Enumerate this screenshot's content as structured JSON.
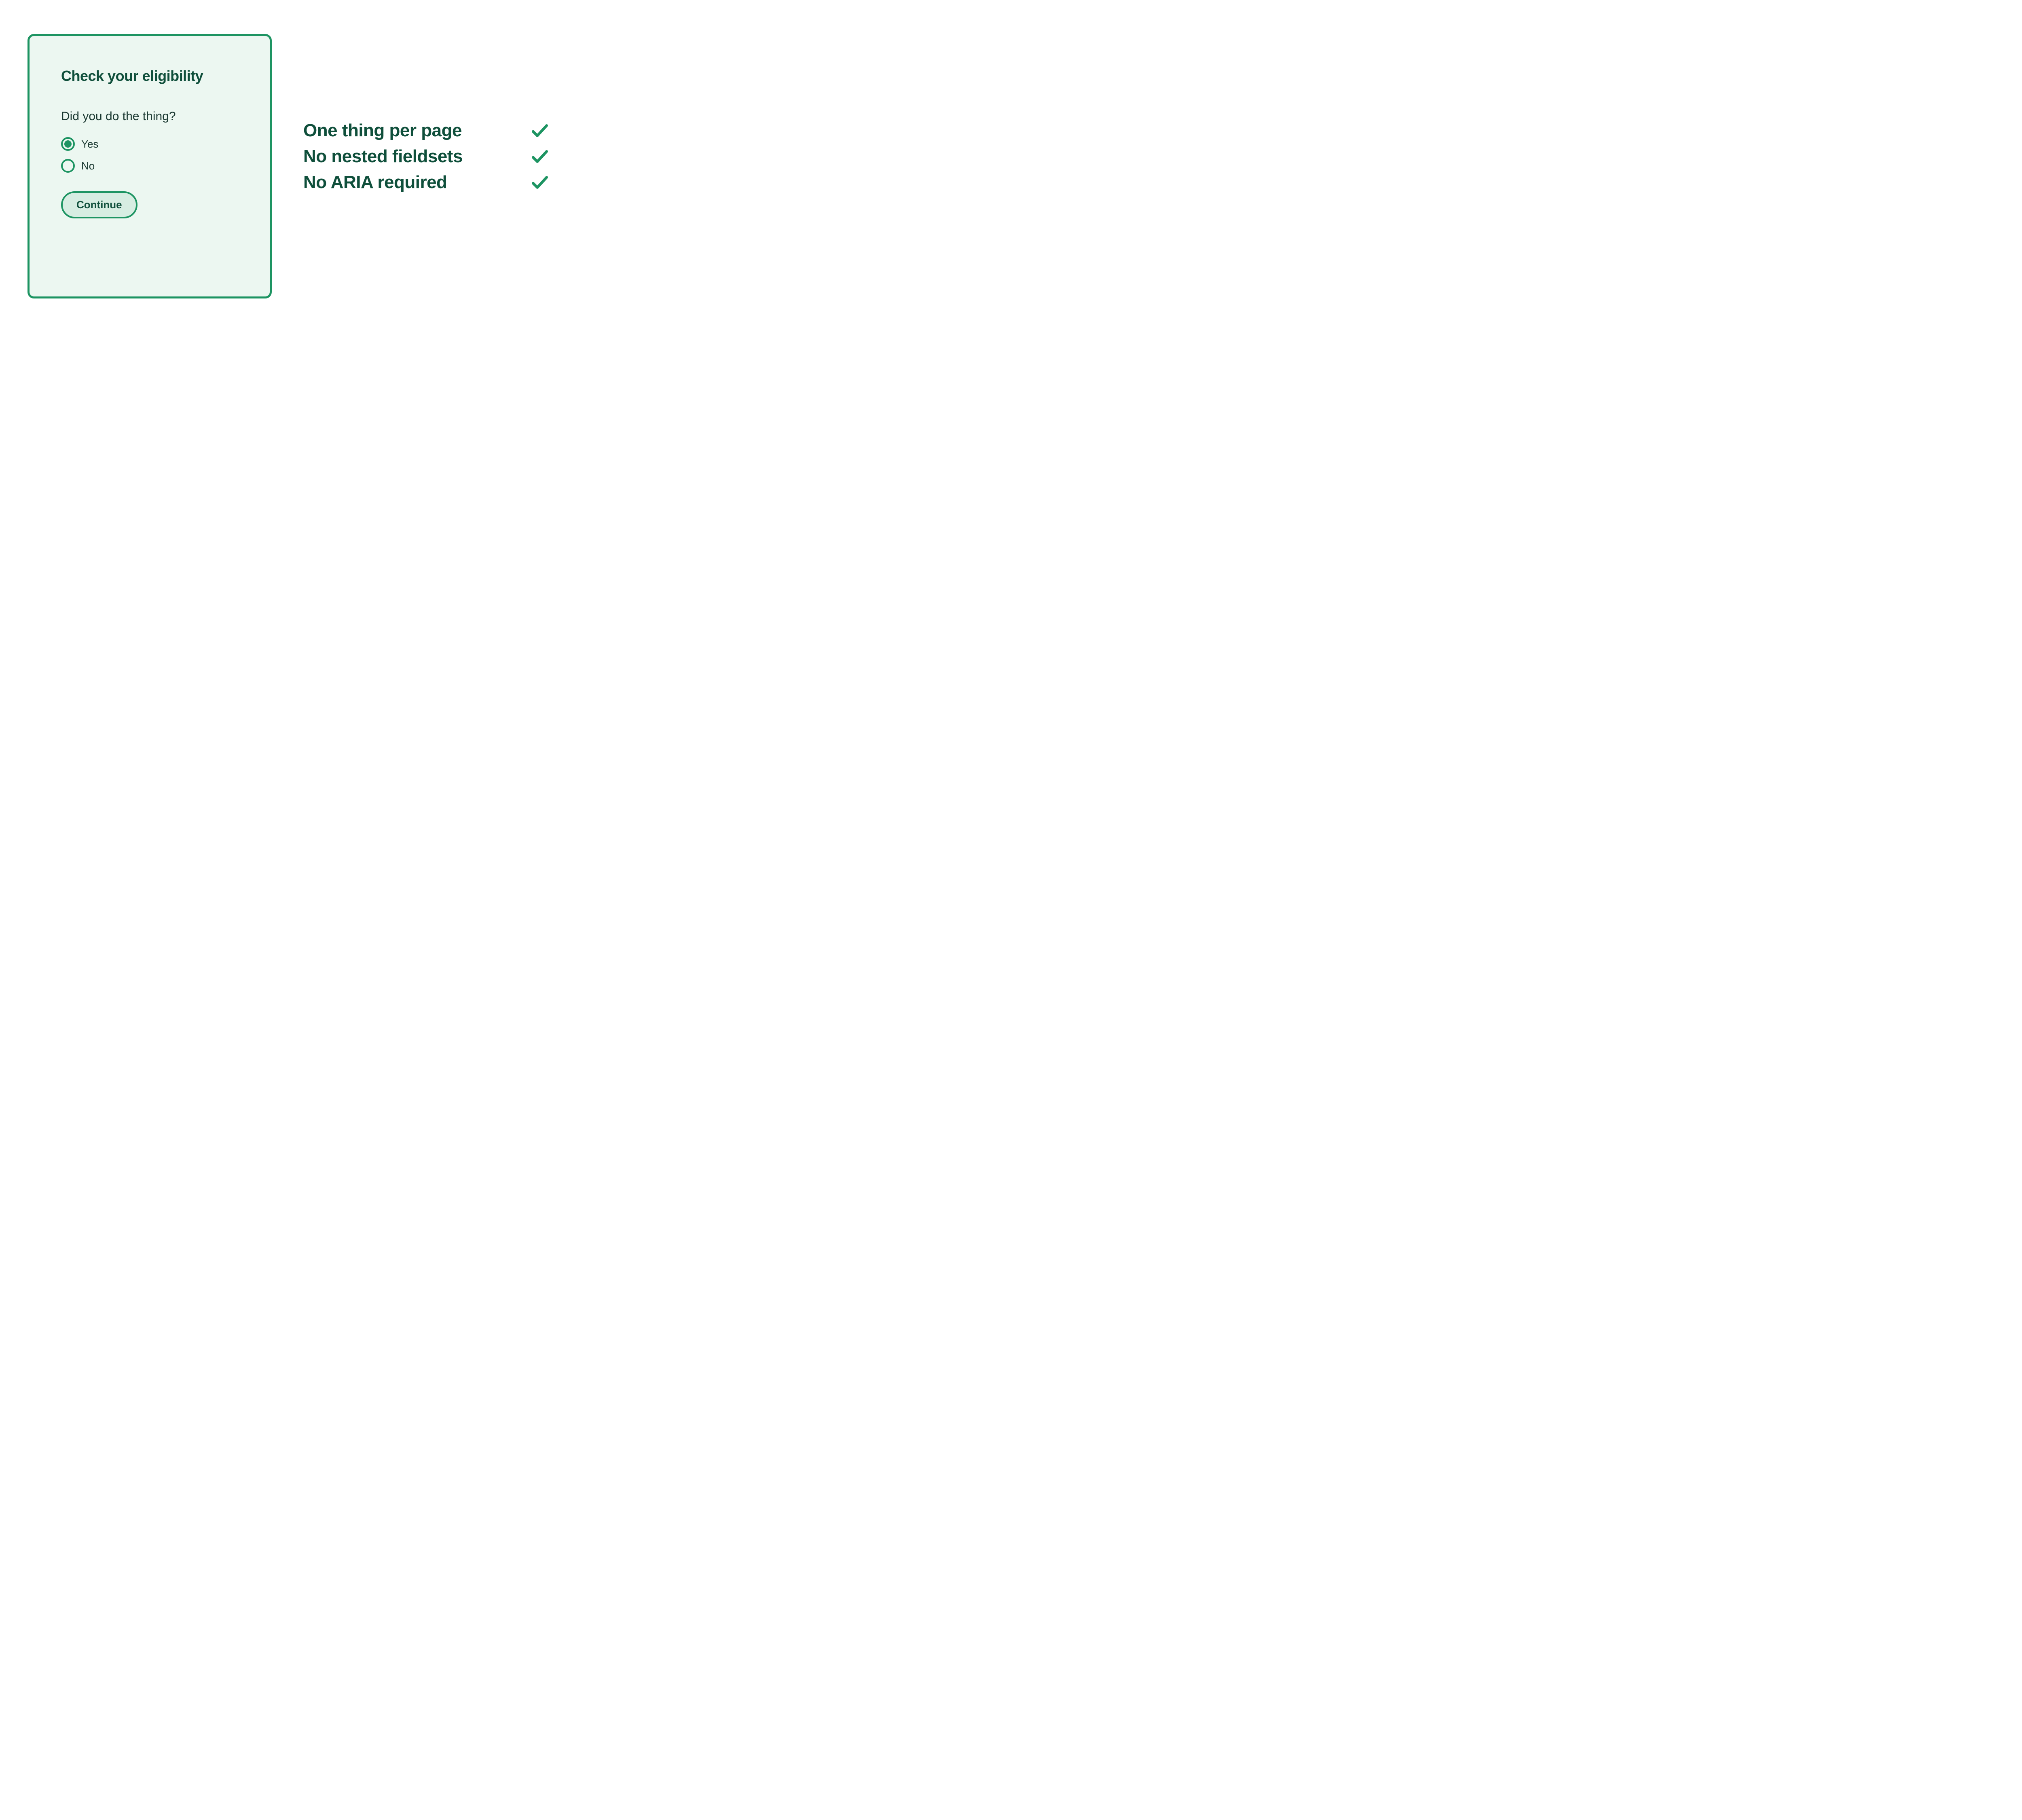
{
  "panel": {
    "title": "Check your eligibility",
    "question": "Did you do the thing?",
    "options": [
      {
        "label": "Yes",
        "selected": true
      },
      {
        "label": "No",
        "selected": false
      }
    ],
    "continue_label": "Continue"
  },
  "checklist": {
    "items": [
      {
        "label": "One thing per page"
      },
      {
        "label": "No nested fieldsets"
      },
      {
        "label": "No ARIA required"
      }
    ]
  },
  "colors": {
    "primary": "#1d9462",
    "dark": "#0f4f3b",
    "panel_bg": "#ecf7f1",
    "btn_bg": "#d7ede2"
  }
}
